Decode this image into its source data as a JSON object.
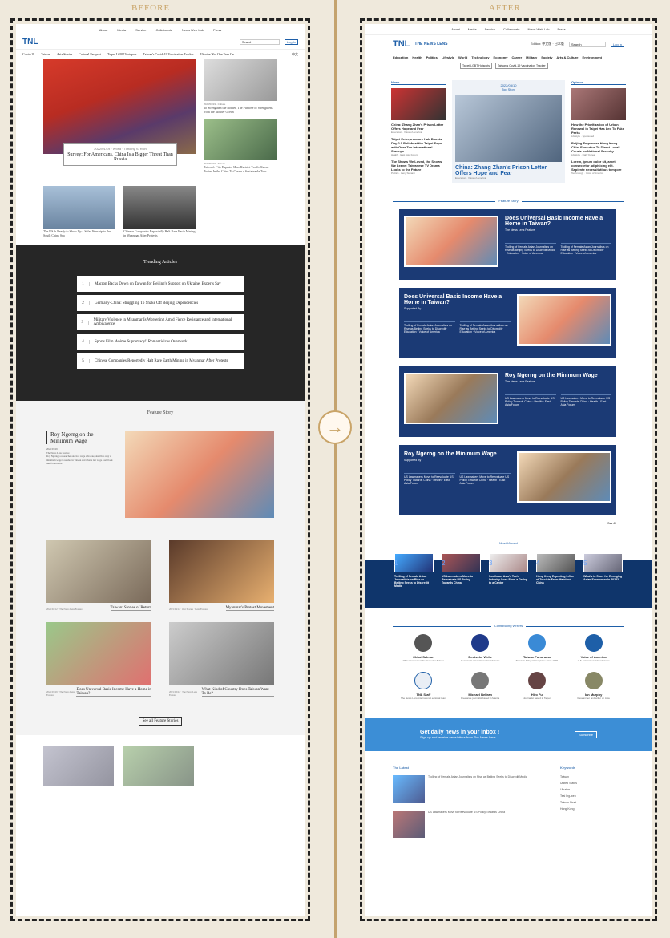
{
  "labels": {
    "before": "BEFORE",
    "after": "AFTER"
  },
  "arrow": "→",
  "old": {
    "top": [
      "About",
      "Media",
      "Service",
      "Collaborate",
      "News Web Lab",
      "Press"
    ],
    "logo": "TNL",
    "search": "Search",
    "login": "Log In",
    "nav": [
      "Covid-19",
      "Taiwan",
      "Asia Stories",
      "Cultural Passport",
      "Taipei LGBT Hotspots",
      "Taiwan's Covid-19 Vaccination Tracker",
      "Ukraine War One Year On",
      "日本語",
      "中文"
    ],
    "hero": {
      "meta": "2022/01/19 · World · Timothy S. Rich",
      "title": "Survey: For Americans, China Is a Bigger Threat Than Russia"
    },
    "side": [
      {
        "meta": "2022/01/19 · Culture",
        "title": "To Strengthen the Border, The Purpose of Strengthens from the Mother Ocean"
      },
      {
        "meta": "2022/01/19 · Taiwan",
        "title": "Taiwan's City Experts: How Restrict Traffic Fewer Toxins In the Cities To Create a Sustainable Tour"
      }
    ],
    "row2": [
      {
        "title": "The US Is Ready to Show Up a Solar Warship to the South China Sea"
      },
      {
        "title": "Chinese Companies Reportedly Halt Rare Earth Mining in Myanmar After Protests"
      }
    ],
    "trending_title": "Trending Articles",
    "trending": [
      {
        "n": "1",
        "t": "Macron Backs Down on Taiwan for Beijing's Support on Ukraine, Experts Say"
      },
      {
        "n": "2",
        "t": "Germany-China: Struggling To Shake Off Beijing Dependencies"
      },
      {
        "n": "3",
        "t": "Military Violence in Myanmar Is Worsening Amid Fierce Resistance and International Ambivalence"
      },
      {
        "n": "4",
        "t": "Sports Film 'Anime Supremacy!' Romanticizes Overwork"
      },
      {
        "n": "5",
        "t": "Chinese Companies Reportedly Halt Rare Earth Mining in Myanmar After Protests"
      }
    ],
    "feature_title": "Feature Story",
    "feature": {
      "title": "Roy Ngerng on the Minimum Wage",
      "meta": "2021/03/29",
      "by": "The News Lens Feature",
      "desc": "Roy Ngerng, a researcher and free wage advocate, describes why a minimum wage is needed in Taiwan and what a fair wage could look like for workers."
    },
    "grid": [
      {
        "meta": "2021/04/12 · The News Lens Feature",
        "title": "Taiwan: Stories of Return"
      },
      {
        "meta": "2021/04/14 · Our Stories · Lens Feature",
        "title": "Myanmar's Protest Movement"
      },
      {
        "meta": "2021/03/29 · The News Lens Feature",
        "title": "Does Universal Basic Income Have a Home in Taiwan?"
      },
      {
        "meta": "2021/03/24 · The News Lens Feature",
        "title": "What Kind of Country Does Taiwan Want To Be?"
      }
    ],
    "see_all": "See all Feature Stories"
  },
  "new": {
    "top": [
      "About",
      "Media",
      "Service",
      "Collaborate",
      "News Web Lab",
      "Press"
    ],
    "logo_main": "TNL",
    "logo_text": "THE NEWS LENS",
    "edition": "Edition: 中文版 · 日本版",
    "search": "Search",
    "login": "Log In",
    "nav": [
      "Education",
      "Health",
      "Politics",
      "Lifestyle",
      "World",
      "Technology",
      "Economy",
      "Career",
      "Military",
      "Society",
      "Arts & Culture",
      "Environment"
    ],
    "pills": [
      "Taipei LGBT Hotspots",
      "Taiwan's Covid-19 Vaccination Tracker"
    ],
    "news_label": "News",
    "opinion_label": "Opinion",
    "top_story_label": "Top Story",
    "news": [
      {
        "t": "China: Zhang Zhan's Prison Letter Offers Hope and Fear",
        "m": "Education · Voice of America"
      },
      {
        "t": "Taipei Entrepreneurs Hub Boosts Day 2.0 Beliefs at the Taipei Expo with Over Too International Startups",
        "m": "Health · East Asia Forum"
      },
      {
        "t": "The Shows We Loved, the Shows We Leave: Taiwanese TV Drama Looks to the Future",
        "m": "Politics · Leny Sunardi"
      }
    ],
    "top_story": {
      "date": "2022/03/10",
      "t": "China: Zhang Zhan's Prison Letter Offers Hope and Fear",
      "m": "Education · Voice of America"
    },
    "opinion": [
      {
        "t": "How the Prioritization of Urban Renewal in Taipei Has Led To Fake Parks",
        "m": "Lifestyle · Sponsored"
      },
      {
        "t": "Beijing Empowers Hong Kong Chief Executive To Direct Local Courts on National Security",
        "m": "Lifestyle · Daily Korea"
      },
      {
        "t": "Lorem, ipsum dolor sit, amet consectetur adipisicing elit. Sapiente necessitatibus tempore",
        "m": "Technology · Voice of America"
      }
    ],
    "see_all": "See All",
    "feature_title": "Feature Story",
    "features": [
      {
        "t": "Does Universal Basic Income Have a Home in Taiwan?",
        "s": "The News Lens Feature",
        "sub": [
          "Trolling of Female Asian Journalists on Rise as Beijing Seeks to Discredit Media · Education · Voice of America",
          "Trolling of Female Asian Journalists on Rise as Beijing Seeks to Discredit · Education · Voice of America"
        ]
      },
      {
        "t": "Does Universal Basic Income Have a Home in Taiwan?",
        "s": "Supported By",
        "sub": [
          "Trolling of Female Asian Journalists on Rise as Beijing Seeks to Discredit · Education · Voice of America",
          "Trolling of Female Asian Journalists on Rise as Beijing Seeks to Discredit · Education · Voice of America"
        ]
      },
      {
        "t": "Roy Ngerng on the Minimum Wage",
        "s": "The News Lens Feature",
        "sub": [
          "US Lawmakers Move to Reevaluate US Policy Towards China · Health · East Asia Forum",
          "US Lawmakers Move to Reevaluate US Policy Towards China · Health · East Asia Forum"
        ]
      },
      {
        "t": "Roy Ngerng on the Minimum Wage",
        "s": "Supported By",
        "sub": [
          "US Lawmakers Move to Reevaluate US Policy Towards China · Health · East Asia Forum",
          "US Lawmakers Move to Reevaluate US Policy Towards China · Health · East Asia Forum"
        ]
      }
    ],
    "most_viewed_title": "Most Viewed",
    "most_viewed": [
      {
        "n": "1",
        "t": "Trolling of Female Asian Journalists on Rise as Beijing Seeks to Discredit Media"
      },
      {
        "n": "2",
        "t": "US Lawmakers Move to Reevaluate US Policy Towards China"
      },
      {
        "n": "3",
        "t": "Southeast Asia's Tech Industry Goes From a Gallop to a Canter"
      },
      {
        "n": "4",
        "t": "Hong Kong Expecting Influx of Tourists From Mainland China"
      },
      {
        "n": "5",
        "t": "What's in Store for Emerging Asian Economies in 2023?"
      }
    ],
    "writers_title": "Contributing Writers",
    "writers": [
      {
        "n": "Chloé Salmon",
        "d": "Writer and researcher based in Taiwan"
      },
      {
        "n": "Deutsche Welle",
        "d": "Germany's international broadcaster"
      },
      {
        "n": "Taiwan Panorama",
        "d": "Taiwan's bilingual magazine since 1976"
      },
      {
        "n": "Voice of America",
        "d": "U.S. international broadcaster"
      },
      {
        "n": "TNL Staff",
        "d": "The News Lens international editorial team"
      },
      {
        "n": "Michael Beltran",
        "d": "Freelance journalist based in Manila"
      },
      {
        "n": "Hiro Fu",
        "d": "Journalist based in Taipei"
      },
      {
        "n": "Ian Murphy",
        "d": "Researcher and writer on Asia"
      }
    ],
    "subscribe": {
      "t": "Get daily news in your inbox !",
      "s": "Sign up and receive newsletters from The News Lens",
      "b": "Subscribe"
    },
    "latest_label": "The Latest",
    "latest": [
      {
        "t": "Trolling of Female Asian Journalists on Rise as Beijing Seeks to Discredit Media"
      },
      {
        "t": "US Lawmakers Move to Reevaluate US Policy Towards China"
      }
    ],
    "keywords_label": "Keywords",
    "keywords": [
      "Taiwan",
      "United States",
      "Ukraine",
      "Tsai Ing-wen",
      "Taiwan Strait",
      "Hong Kong"
    ]
  }
}
